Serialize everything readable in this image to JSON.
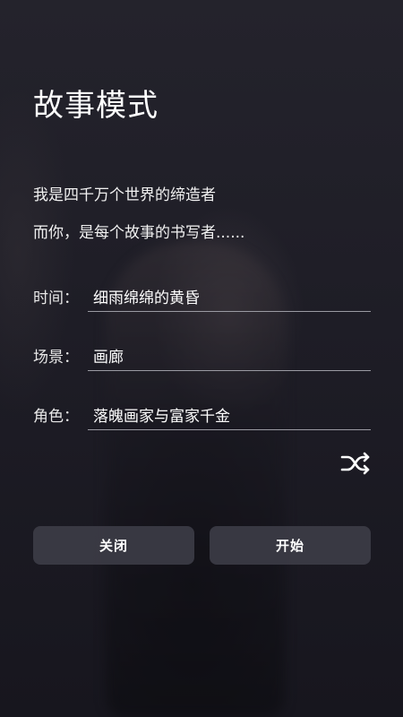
{
  "page": {
    "title": "故事模式",
    "intro_lines": [
      "我是四千万个世界的缔造者",
      "而你，是每个故事的书写者......"
    ]
  },
  "form": {
    "time": {
      "label": "时间：",
      "value": "细雨绵绵的黄昏"
    },
    "scene": {
      "label": "场景：",
      "value": "画廊"
    },
    "role": {
      "label": "角色：",
      "value": "落魄画家与富家千金"
    }
  },
  "actions": {
    "shuffle_icon": "shuffle-icon",
    "close_label": "关闭",
    "start_label": "开始"
  },
  "colors": {
    "background": "#1b1a22",
    "button": "#3e3e48",
    "underline": "#9a9aa2",
    "text": "#ffffff"
  }
}
